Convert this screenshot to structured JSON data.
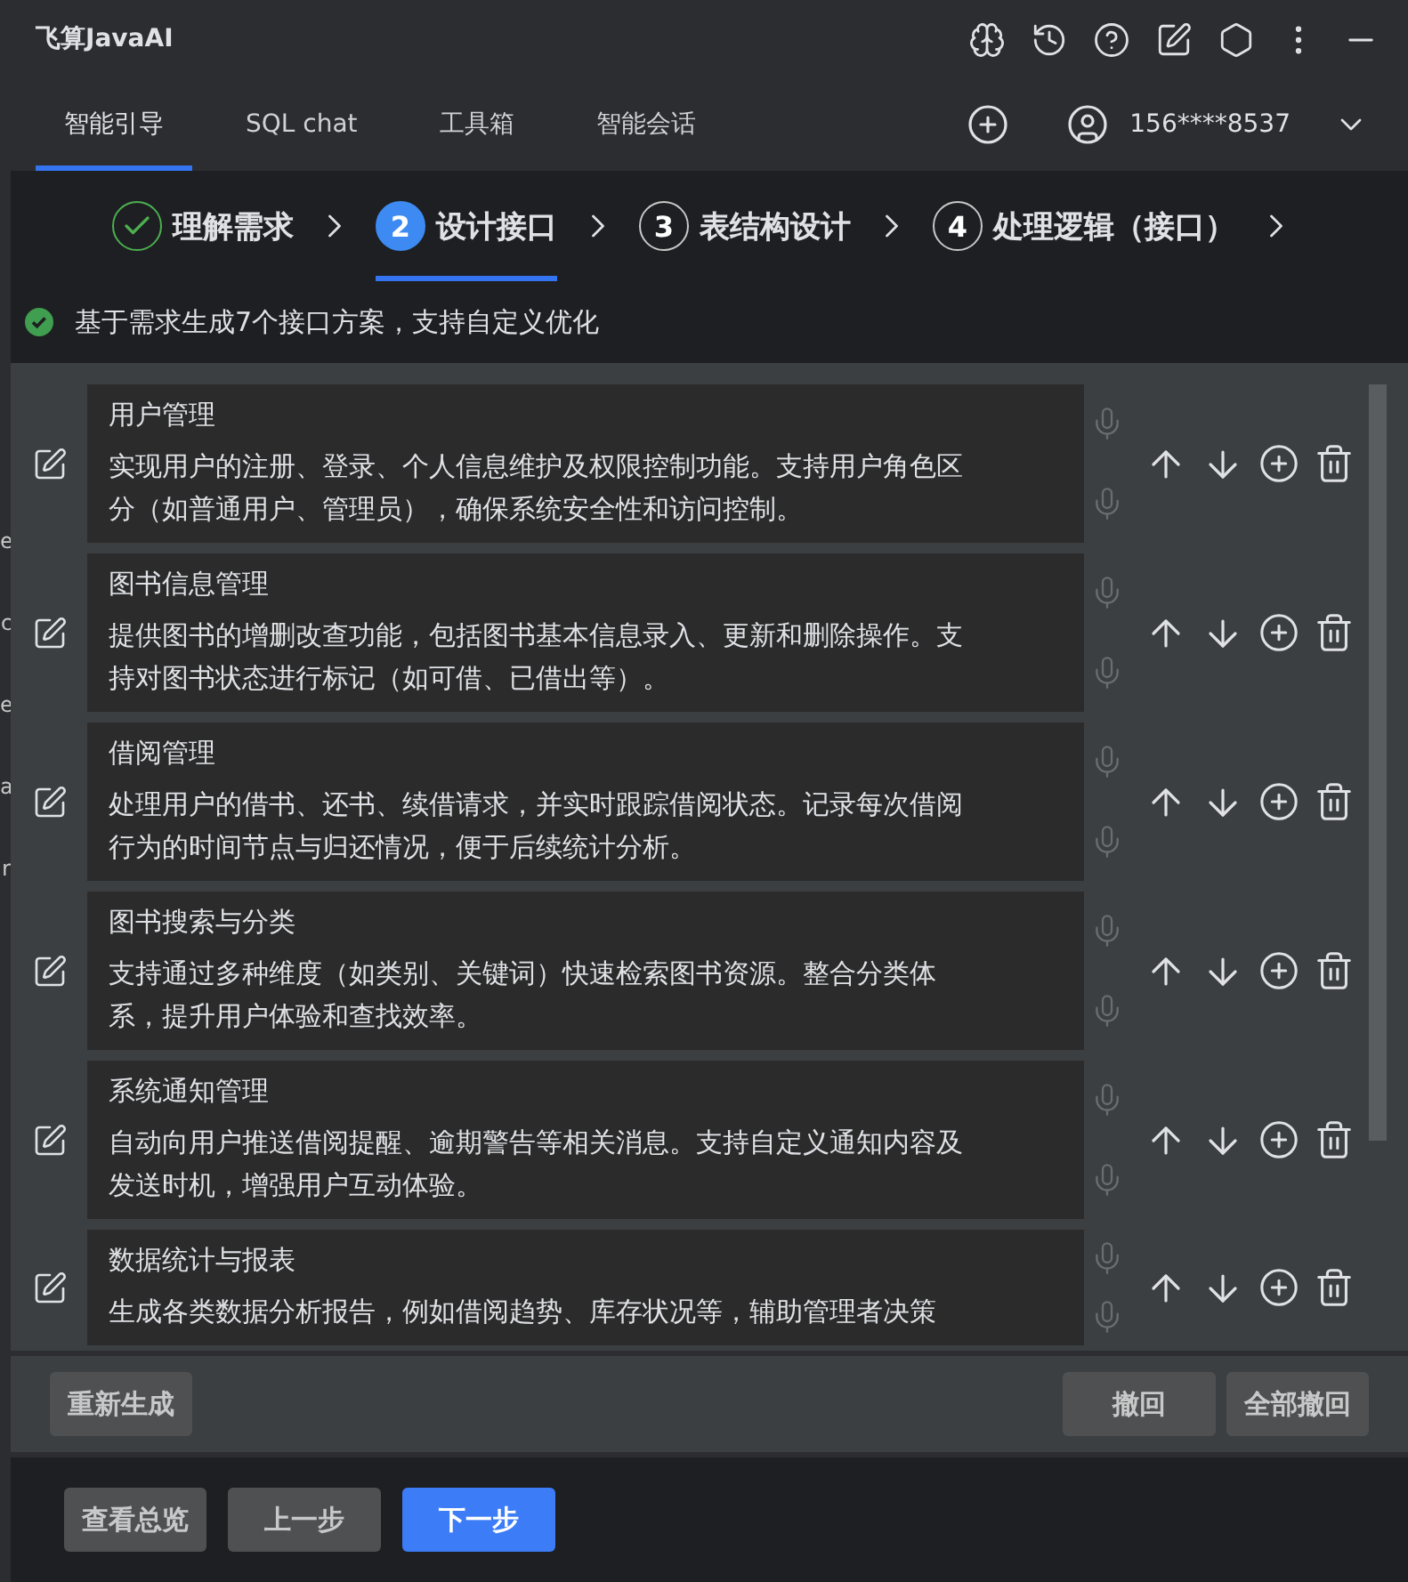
{
  "window": {
    "title": "飞算JavaAI"
  },
  "tabs": [
    {
      "label": "智能引导",
      "selected": true
    },
    {
      "label": "SQL chat",
      "selected": false
    },
    {
      "label": "工具箱",
      "selected": false
    },
    {
      "label": "智能会话",
      "selected": false
    }
  ],
  "account": {
    "phone": "156****8537"
  },
  "editor_edge": [
    "e",
    "c",
    "e",
    "a",
    "r"
  ],
  "steps": [
    {
      "label": "理解需求",
      "completed": true,
      "selected": false
    },
    {
      "number": "2",
      "label": "设计接口",
      "completed": false,
      "selected": true
    },
    {
      "number": "3",
      "label": "表结构设计",
      "completed": false,
      "selected": false
    },
    {
      "number": "4",
      "label": "处理逻辑（接口）",
      "completed": false,
      "selected": false
    }
  ],
  "status_message": "基于需求生成7个接口方案，支持自定义优化",
  "interfaces": [
    {
      "title": "用户管理",
      "description": "实现用户的注册、登录、个人信息维护及权限控制功能。支持用户角色区分（如普通用户、管理员），确保系统安全性和访问控制。"
    },
    {
      "title": "图书信息管理",
      "description": "提供图书的增删改查功能，包括图书基本信息录入、更新和删除操作。支持对图书状态进行标记（如可借、已借出等）。"
    },
    {
      "title": "借阅管理",
      "description": "处理用户的借书、还书、续借请求，并实时跟踪借阅状态。记录每次借阅行为的时间节点与归还情况，便于后续统计分析。"
    },
    {
      "title": "图书搜索与分类",
      "description": "支持通过多种维度（如类别、关键词）快速检索图书资源。整合分类体系，提升用户体验和查找效率。"
    },
    {
      "title": "系统通知管理",
      "description": "自动向用户推送借阅提醒、逾期警告等相关消息。支持自定义通知内容及发送时机，增强用户互动体验。"
    },
    {
      "title": "数据统计与报表",
      "description": "生成各类数据分析报告，例如借阅趋势、库存状况等，辅助管理者决策"
    }
  ],
  "actions": {
    "regenerate": "重新生成",
    "undo": "撤回",
    "undo_all": "全部撤回"
  },
  "footer": {
    "overview": "查看总览",
    "previous": "上一步",
    "next": "下一步"
  }
}
